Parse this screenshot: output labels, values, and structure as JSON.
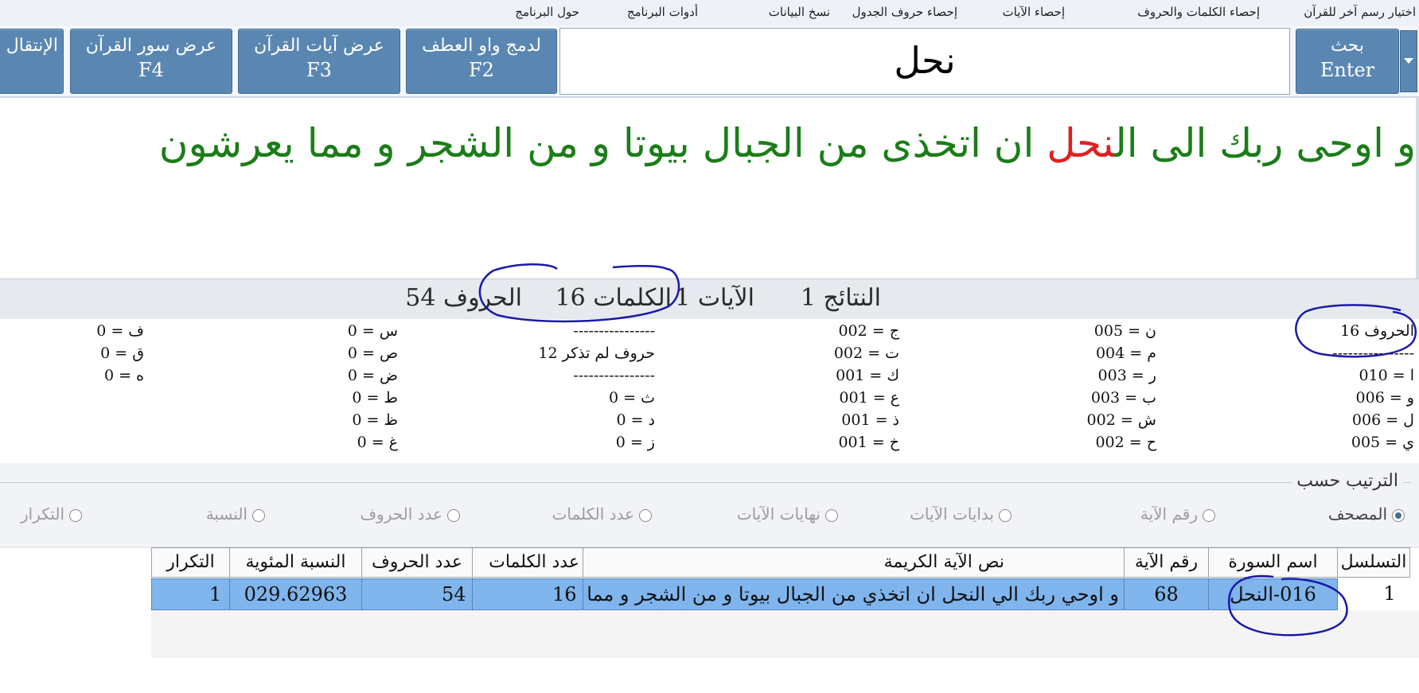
{
  "menu": [
    "اختيار رسم آخر للقرآن",
    "إحصاء الكلمات والحروف",
    "إحصاء الآيات",
    "إحصاء حروف الجدول",
    "نسخ البيانات",
    "أدوات البرنامج",
    "حول البرنامج"
  ],
  "toolbar": {
    "search_btn": {
      "label": "بحث",
      "key": "Enter"
    },
    "search_value": "نحل",
    "merge_btn": {
      "label": "لدمج واو العطف",
      "key": "F2"
    },
    "ayat_btn": {
      "label": "عرض آيات القرآن",
      "key": "F3"
    },
    "surah_btn": {
      "label": "عرض سور القرآن",
      "key": "F4"
    },
    "move_btn": {
      "label": "الإنتقال"
    }
  },
  "verse": {
    "before": "و اوحى ربك الى ال",
    "highlight": "نحل",
    "after": " ان اتخذى من الجبال بيوتا و من الشجر و مما يعرشون"
  },
  "summary": {
    "results": "النتائج 1",
    "ayat": "الآيات 1",
    "words": "الكلمات 16",
    "letters": "الحروف 54"
  },
  "letter_stats": {
    "col1": [
      "الحروف 16",
      "----------------",
      "ا = 010",
      "و = 006",
      "ل = 006",
      "ي = 005"
    ],
    "col2": [
      "ن = 005",
      "م = 004",
      "ر = 003",
      "ب = 003",
      "ش = 002",
      "ح = 002"
    ],
    "col3": [
      "ج = 002",
      "ت = 002",
      "ك = 001",
      "ع = 001",
      "ذ = 001",
      "خ = 001"
    ],
    "col4": [
      "----------------",
      "حروف لم تذكر 12",
      "----------------",
      "ث = 0",
      "د = 0",
      "ز = 0"
    ],
    "col5": [
      "س = 0",
      "ص = 0",
      "ض = 0",
      "ط = 0",
      "ظ = 0",
      "غ = 0"
    ],
    "col6": [
      "ف = 0",
      "ق = 0",
      "ه = 0"
    ]
  },
  "sort": {
    "legend": "الترتيب حسب",
    "options": [
      "المصحف",
      "رقم الآية",
      "بدايات الآيات",
      "نهايات الآيات",
      "عدد الكلمات",
      "عدد الحروف",
      "النسبة",
      "التكرار"
    ]
  },
  "table": {
    "headers": [
      "التسلسل",
      "اسم السورة",
      "رقم الآية",
      "نص الآية الكريمة",
      "عدد الكلمات",
      "عدد الحروف",
      "النسبة المئوية",
      "التكرار"
    ],
    "rows": [
      [
        "1",
        "016-النحل",
        "68",
        "و اوحي ربك الي النحل ان اتخذي من الجبال بيوتا و من الشجر و مما يعرشون",
        "16",
        "54",
        "029.62963",
        "1"
      ]
    ]
  },
  "colors": {
    "button": "#5a87b2",
    "verse_text": "#1b7d18",
    "highlight": "#e02020",
    "selected_row": "#7fb4ec",
    "annotation_ink": "#1a1aa8"
  }
}
